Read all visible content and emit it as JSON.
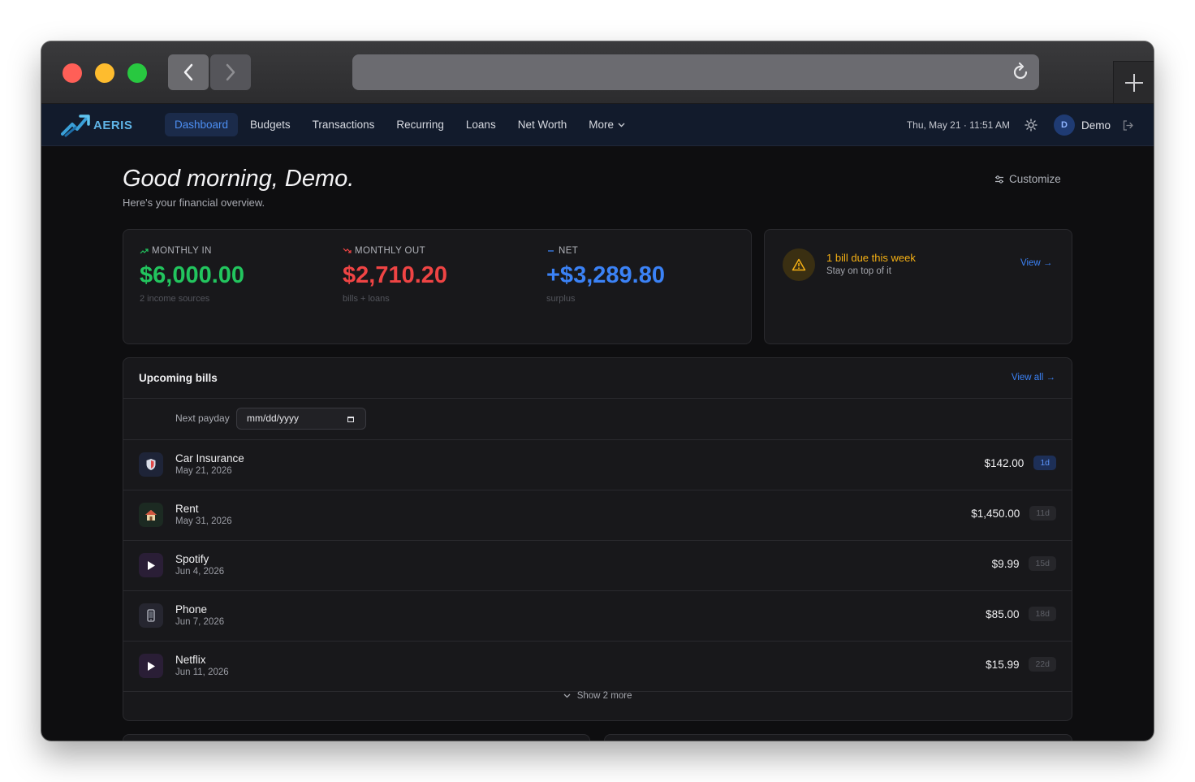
{
  "app": {
    "brand": "AERIS",
    "nav": [
      "Dashboard",
      "Budgets",
      "Transactions",
      "Recurring",
      "Loans",
      "Net Worth",
      "More"
    ],
    "active_nav": "Dashboard",
    "datetime": "Thu, May 21 · 11:51 AM",
    "avatar_initial": "D",
    "username": "Demo"
  },
  "greeting": {
    "title": "Good morning, Demo.",
    "subtitle": "Here's your financial overview.",
    "customize_label": "Customize"
  },
  "stats": [
    {
      "label": "MONTHLY IN",
      "value": "$6,000.00",
      "sub": "2 income sources",
      "color": "#22c55e"
    },
    {
      "label": "MONTHLY OUT",
      "value": "$2,710.20",
      "sub": "bills + loans",
      "color": "#ef4444"
    },
    {
      "label": "NET",
      "value": "+$3,289.80",
      "sub": "surplus",
      "color": "#3b82f6"
    }
  ],
  "alert": {
    "title": "1 bill due this week",
    "subtitle": "Stay on top of it",
    "action": "View →"
  },
  "bills": {
    "title": "Upcoming bills",
    "view_all": "View all →",
    "payday_label": "Next payday",
    "payday_placeholder": "mm/dd/yyyy",
    "items": [
      {
        "name": "Car Insurance",
        "date": "May 21, 2026",
        "amount": "$142.00",
        "badge": "1d",
        "icon": "shield-icon"
      },
      {
        "name": "Rent",
        "date": "May 31, 2026",
        "amount": "$1,450.00",
        "badge": "11d",
        "icon": "house-icon"
      },
      {
        "name": "Spotify",
        "date": "Jun 4, 2026",
        "amount": "$9.99",
        "badge": "15d",
        "icon": "play-icon"
      },
      {
        "name": "Phone",
        "date": "Jun 7, 2026",
        "amount": "$85.00",
        "badge": "18d",
        "icon": "phone-icon"
      },
      {
        "name": "Netflix",
        "date": "Jun 11, 2026",
        "amount": "$15.99",
        "badge": "22d",
        "icon": "play-icon"
      }
    ],
    "show_more": "Show 2 more"
  }
}
